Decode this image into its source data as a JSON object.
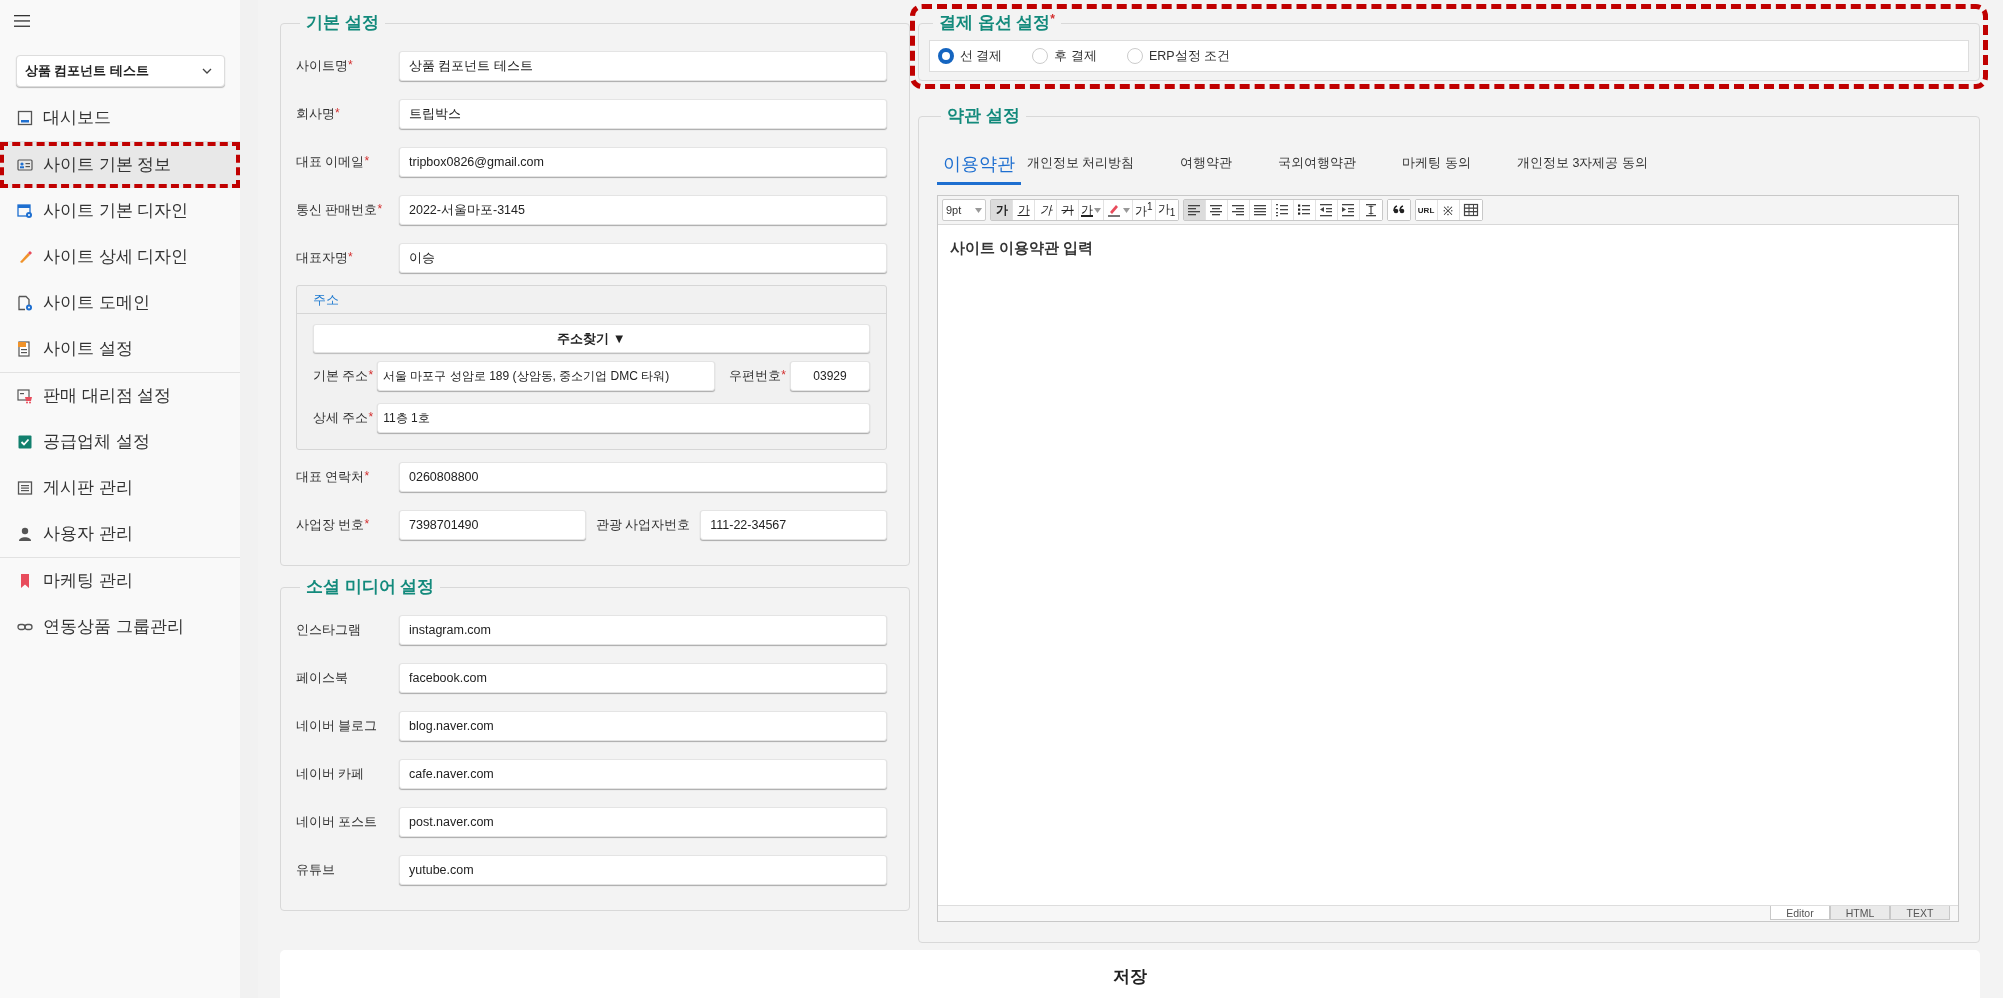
{
  "sidebar": {
    "site_select": "상품 컴포넌트 테스트",
    "sections": [
      {
        "items": [
          {
            "label": "대시보드",
            "selected": false,
            "highlighted": false
          }
        ]
      },
      {
        "items": [
          {
            "label": "사이트 기본 정보",
            "selected": true,
            "highlighted": true
          },
          {
            "label": "사이트 기본 디자인",
            "selected": false,
            "highlighted": false
          },
          {
            "label": "사이트 상세 디자인",
            "selected": false,
            "highlighted": false
          },
          {
            "label": "사이트 도메인",
            "selected": false,
            "highlighted": false
          },
          {
            "label": "사이트 설정",
            "selected": false,
            "highlighted": false
          }
        ]
      },
      {
        "items": [
          {
            "label": "판매 대리점 설정",
            "selected": false,
            "highlighted": false
          },
          {
            "label": "공급업체 설정",
            "selected": false,
            "highlighted": false
          },
          {
            "label": "게시판 관리",
            "selected": false,
            "highlighted": false
          },
          {
            "label": "사용자 관리",
            "selected": false,
            "highlighted": false
          }
        ]
      },
      {
        "items": [
          {
            "label": "마케팅 관리",
            "selected": false,
            "highlighted": false
          },
          {
            "label": "연동상품 그룹관리",
            "selected": false,
            "highlighted": false
          }
        ]
      }
    ]
  },
  "basic_settings": {
    "title": "기본 설정",
    "rows_top": [
      {
        "fields": [
          {
            "label": "사이트명",
            "mark": "*",
            "value": "상품 컴포넌트 테스트"
          }
        ]
      },
      {
        "fields": [
          {
            "label": "회사명",
            "mark": "*",
            "value": "트립박스"
          }
        ]
      },
      {
        "fields": [
          {
            "label": "대표 이메일",
            "mark": "*",
            "value": "tripbox0826@gmail.com"
          }
        ]
      },
      {
        "fields": [
          {
            "label": "통신 판매번호",
            "mark": "*",
            "value": "2022-서울마포-3145"
          }
        ]
      },
      {
        "fields": [
          {
            "label": "대표자명",
            "mark": "*",
            "value": "이승"
          }
        ]
      }
    ],
    "address": {
      "title": "주소",
      "search_button": "주소찾기 ▼",
      "rows": [
        {
          "fields": [
            {
              "label": "기본 주소",
              "mark": "*",
              "value": "서울 마포구 성암로 189 (상암동, 중소기업 DMC 타워)"
            },
            {
              "label": "우편번호",
              "mark": "*",
              "value": "03929"
            }
          ]
        },
        {
          "fields": [
            {
              "label": "상세 주소",
              "mark": "*",
              "value": "11층 1호"
            }
          ]
        }
      ]
    },
    "rows_bottom": [
      {
        "fields": [
          {
            "label": "대표 연락처",
            "mark": "*",
            "value": "0260808800"
          }
        ]
      },
      {
        "fields": [
          {
            "label": "사업장 번호",
            "mark": "*",
            "value": "7398701490"
          },
          {
            "label": "관광 사업자번호",
            "value": "111-22-34567"
          }
        ]
      }
    ]
  },
  "social_settings": {
    "title": "소셜 미디어 설정",
    "fields": [
      {
        "label": "인스타그램",
        "value": "instagram.com"
      },
      {
        "label": "페이스북",
        "value": "facebook.com"
      },
      {
        "label": "네이버 블로그",
        "value": "blog.naver.com"
      },
      {
        "label": "네이버 카페",
        "value": "cafe.naver.com"
      },
      {
        "label": "네이버 포스트",
        "value": "post.naver.com"
      },
      {
        "label": "유튜브",
        "value": "yutube.com"
      }
    ]
  },
  "payment_settings": {
    "title": "결제 옵션 설정",
    "mark": "*",
    "highlighted": true,
    "options": [
      {
        "label": "선 결제",
        "selected": true
      },
      {
        "label": "후 결제",
        "selected": false
      },
      {
        "label": "ERP설정 조건",
        "selected": false
      }
    ]
  },
  "terms_settings": {
    "title": "약관 설정",
    "tabs": [
      {
        "label": "이용약관",
        "selected": true
      },
      {
        "label": "개인정보 처리방침",
        "selected": false
      },
      {
        "label": "여행약관",
        "selected": false
      },
      {
        "label": "국외여행약관",
        "selected": false
      },
      {
        "label": "마케팅 동의",
        "selected": false
      },
      {
        "label": "개인정보 3자제공 동의",
        "selected": false
      }
    ],
    "editor": {
      "font_size": "9pt",
      "toolbar_groups": [
        {
          "buttons": [
            {
              "kind": "bold",
              "label": "가",
              "selected": true
            },
            {
              "kind": "underline",
              "label": "가",
              "selected": false
            },
            {
              "kind": "italic",
              "label": "가",
              "selected": false
            },
            {
              "kind": "strike",
              "label": "가",
              "selected": false
            },
            {
              "kind": "color",
              "label": "가",
              "selected": false
            },
            {
              "kind": "highlight",
              "selected": false
            },
            {
              "kind": "sup",
              "label": "가$^{1}$",
              "selected": false
            },
            {
              "kind": "sub",
              "label": "가$_{1}$",
              "selected": false
            }
          ]
        },
        {
          "buttons": [
            {
              "kind": "left",
              "selected": true
            },
            {
              "kind": "center",
              "selected": false
            },
            {
              "kind": "right",
              "selected": false
            },
            {
              "kind": "justify",
              "selected": false
            },
            {
              "kind": "ol",
              "selected": false
            },
            {
              "kind": "ul",
              "selected": false
            },
            {
              "kind": "outdent",
              "selected": false
            },
            {
              "kind": "indent",
              "selected": false
            },
            {
              "kind": "spacing",
              "selected": false
            }
          ]
        },
        {
          "buttons": [
            {
              "kind": "quote",
              "selected": false
            }
          ]
        },
        {
          "buttons": [
            {
              "kind": "url",
              "label": "URL",
              "selected": false
            },
            {
              "kind": "symbol",
              "label": "※",
              "selected": false
            },
            {
              "kind": "table",
              "selected": false
            }
          ]
        }
      ],
      "content": "사이트 이용약관 입력",
      "modes": [
        {
          "label": "Editor",
          "selected": true
        },
        {
          "label": "HTML",
          "selected": false
        },
        {
          "label": "TEXT",
          "selected": false
        }
      ]
    }
  },
  "save_button": "저장"
}
